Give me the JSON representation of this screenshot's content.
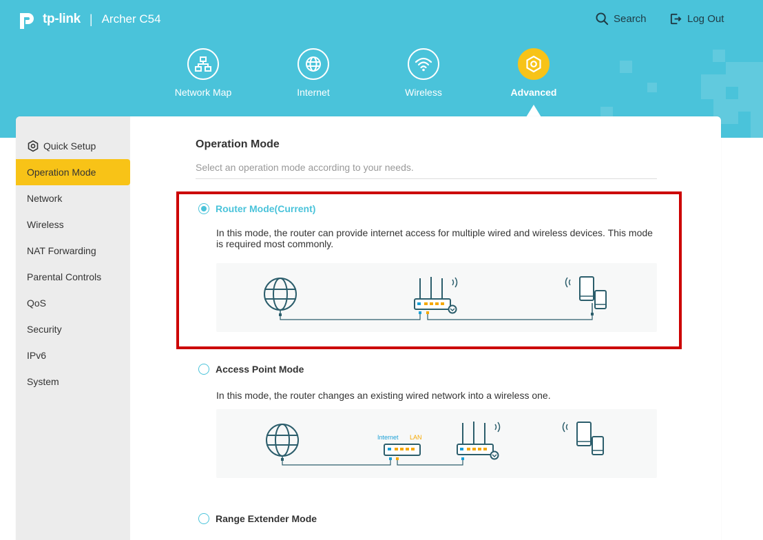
{
  "header": {
    "brand": "tp-link",
    "separator": "|",
    "model": "Archer C54",
    "search_label": "Search",
    "logout_label": "Log Out"
  },
  "nav": {
    "items": [
      {
        "label": "Network Map",
        "icon": "network-map-icon"
      },
      {
        "label": "Internet",
        "icon": "globe-icon"
      },
      {
        "label": "Wireless",
        "icon": "wifi-icon"
      },
      {
        "label": "Advanced",
        "icon": "gear-icon",
        "active": true
      }
    ]
  },
  "sidebar": {
    "items": [
      {
        "label": "Quick Setup",
        "icon": "gear-icon"
      },
      {
        "label": "Operation Mode",
        "active": true
      },
      {
        "label": "Network"
      },
      {
        "label": "Wireless"
      },
      {
        "label": "NAT Forwarding"
      },
      {
        "label": "Parental Controls"
      },
      {
        "label": "QoS"
      },
      {
        "label": "Security"
      },
      {
        "label": "IPv6"
      },
      {
        "label": "System"
      }
    ]
  },
  "main": {
    "title": "Operation Mode",
    "subtitle": "Select an operation mode according to your needs.",
    "modes": [
      {
        "label": "Router Mode(Current)",
        "selected": true,
        "description": "In this mode, the router can provide internet access for multiple wired and wireless devices. This mode is required most commonly."
      },
      {
        "label": "Access Point Mode",
        "selected": false,
        "description": "In this mode, the router changes an existing wired network into a wireless one.",
        "diagram_labels": {
          "internet": "Internet",
          "lan": "LAN"
        }
      },
      {
        "label": "Range Extender Mode",
        "selected": false
      }
    ]
  },
  "colors": {
    "header_bg": "#4ac3da",
    "accent_yellow": "#f7c318",
    "highlight_red": "#cc0000",
    "diagram_line": "#2b5d6b",
    "port_blue": "#1a9fd6",
    "port_yellow": "#f5a800"
  }
}
